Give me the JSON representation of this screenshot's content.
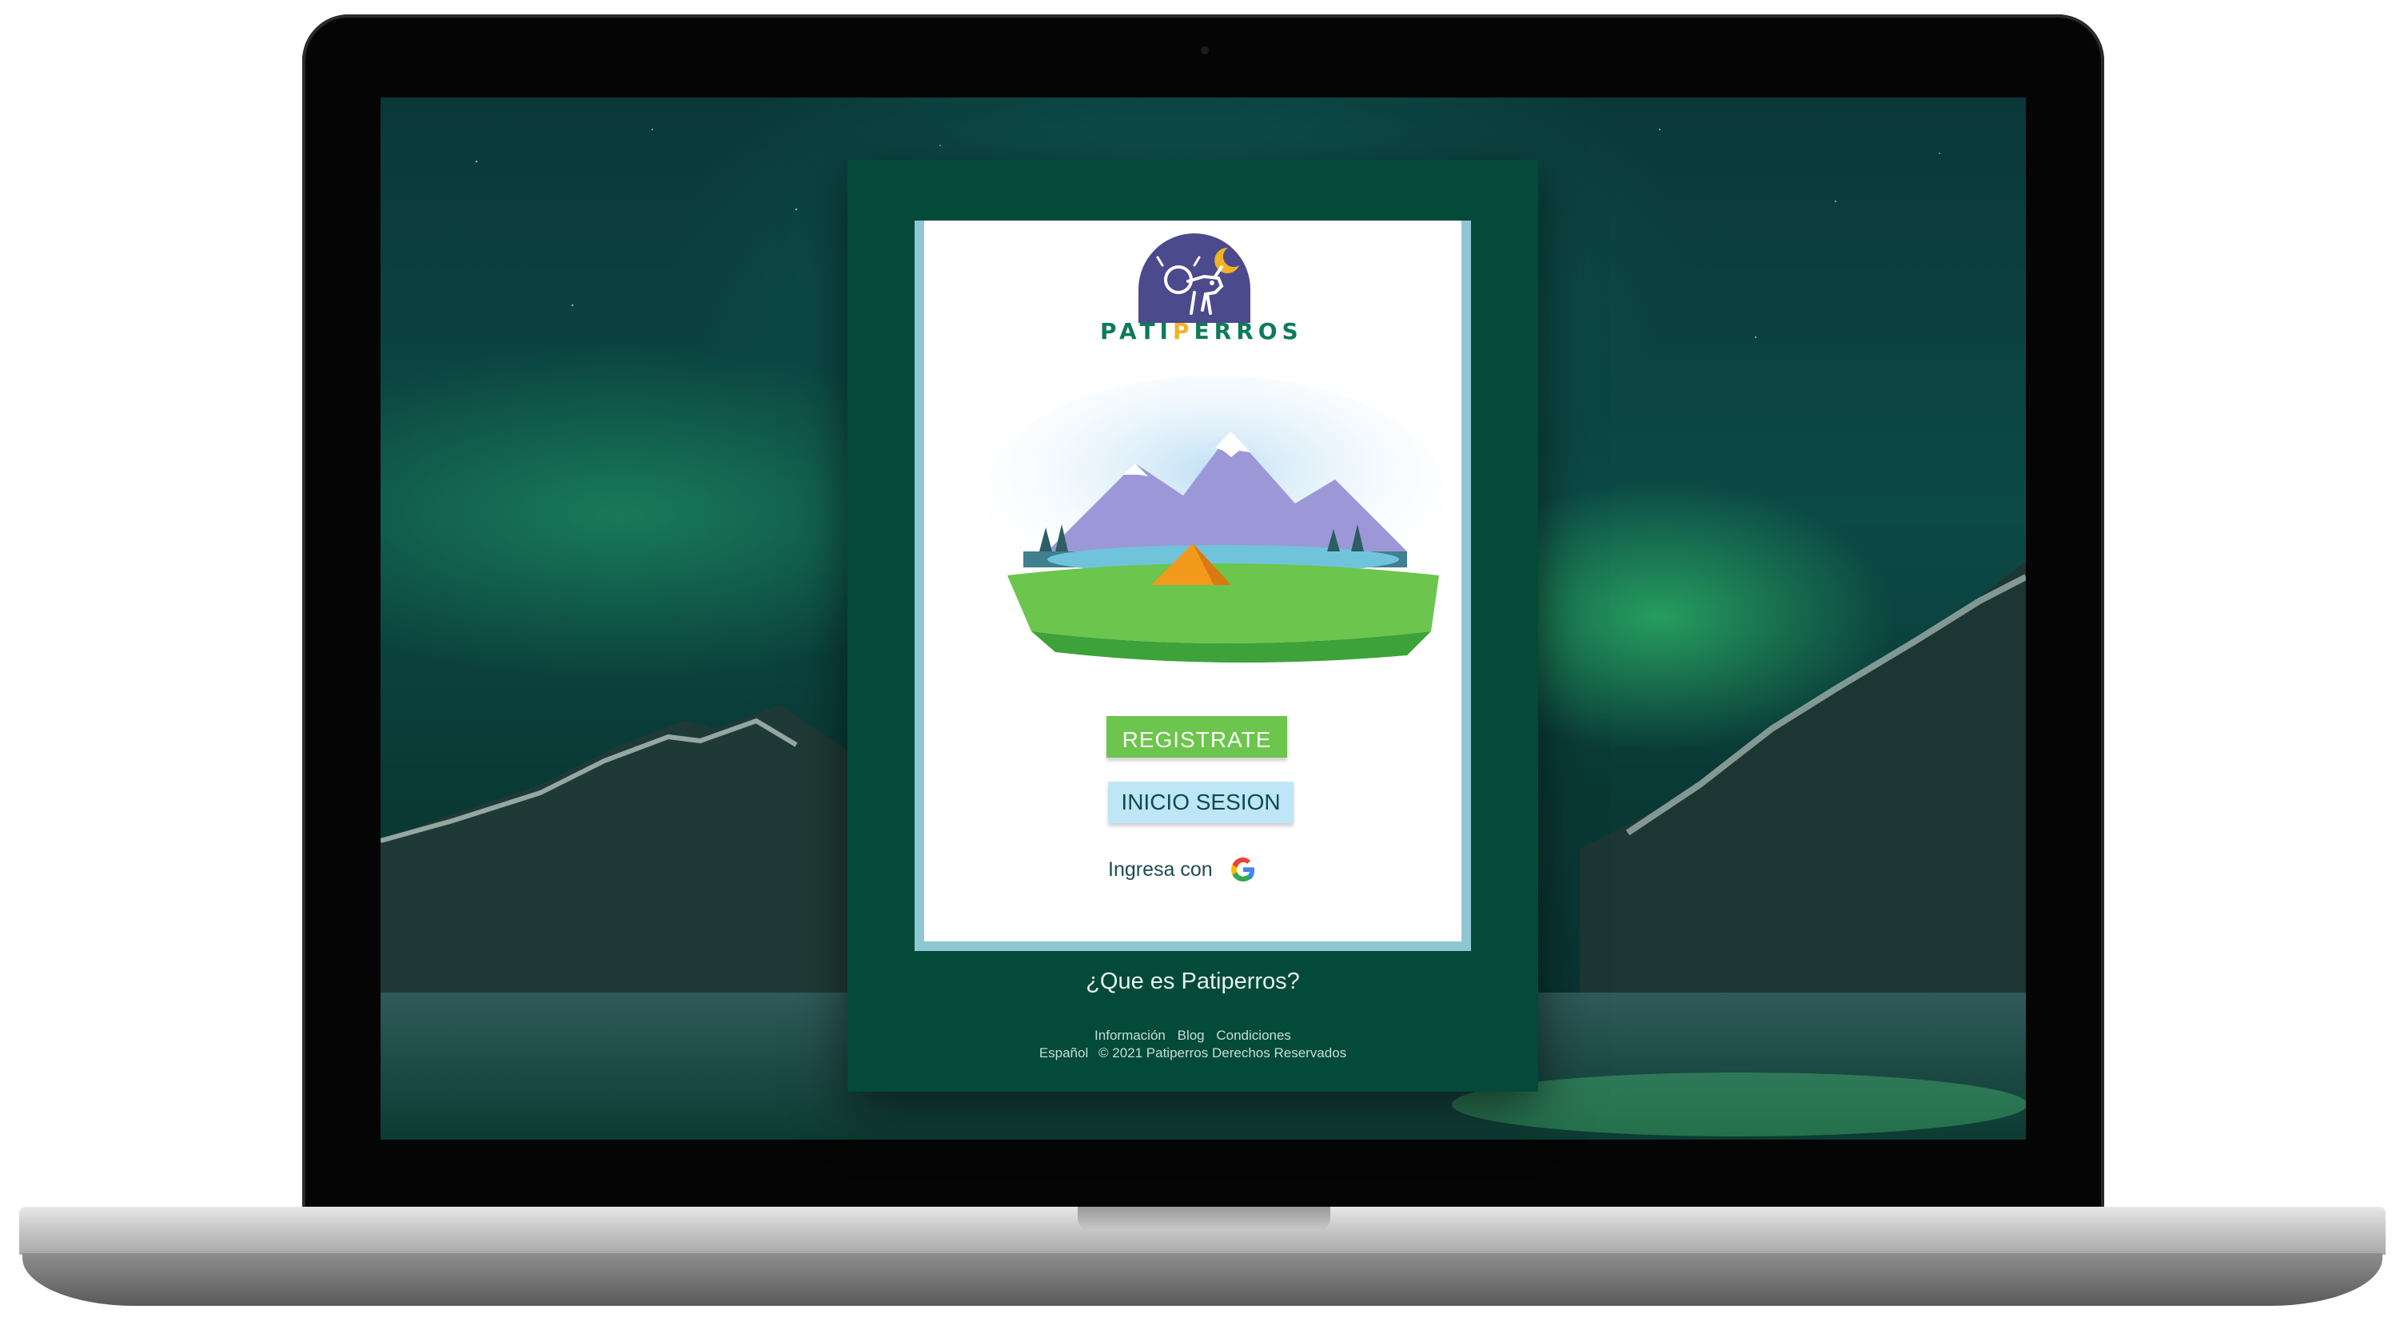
{
  "brand": {
    "name_prefix": "PATI",
    "name_accent": "P",
    "name_suffix": "ERROS",
    "logo_icon": "dog-and-moon-icon"
  },
  "actions": {
    "register_label": "REGISTRATE",
    "login_label": "INICIO SESION",
    "google_label": "Ingresa con",
    "google_icon": "google-icon"
  },
  "info_link": "¿Que es Patiperros?",
  "footer": {
    "links": [
      "Información",
      "Blog",
      "Condiciones"
    ],
    "language": "Español",
    "copyright": "© 2021 Patiperros Derechos Reservados"
  },
  "colors": {
    "card_background": "#034a38",
    "register_button": "#6cc54c",
    "login_button": "#bfe6f6",
    "logo_circle": "#4b4a8c",
    "logo_accent": "#f0b324",
    "logo_text": "#0f7a5a"
  }
}
